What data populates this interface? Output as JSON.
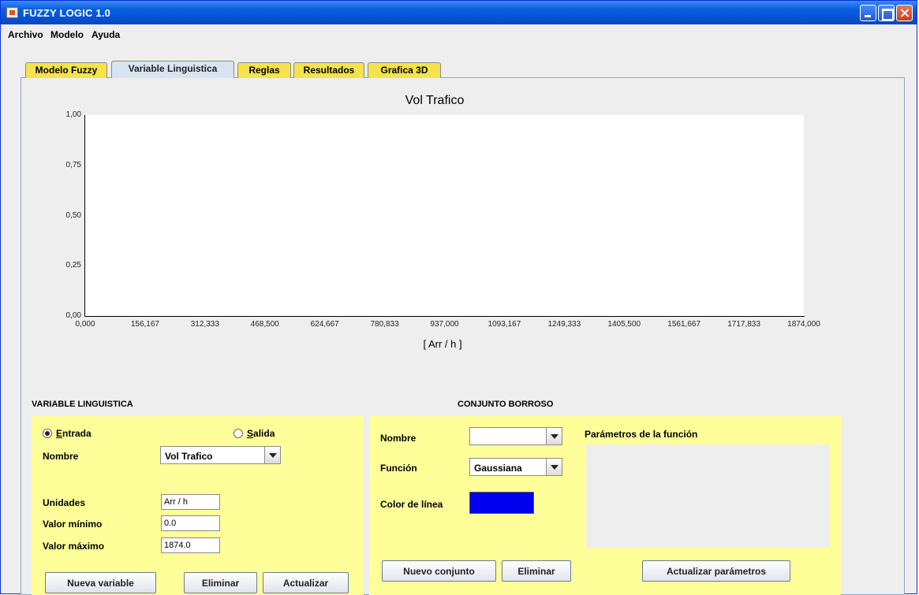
{
  "window": {
    "title": "FUZZY LOGIC 1.0"
  },
  "menu": [
    "Archivo",
    "Modelo",
    "Ayuda"
  ],
  "tabs": [
    "Modelo Fuzzy",
    "Variable Linguistica",
    "Reglas",
    "Resultados",
    "Grafica 3D"
  ],
  "active_tab": "Variable Linguistica",
  "chart_data": {
    "type": "line",
    "title": "Vol Trafico",
    "xlabel": "[ Arr / h ]",
    "ylabel": "",
    "xlim": [
      0,
      1874
    ],
    "ylim": [
      0,
      1
    ],
    "x_ticks": [
      "0,000",
      "156,167",
      "312,333",
      "468,500",
      "624,667",
      "780,833",
      "937,000",
      "1093,167",
      "1249,333",
      "1405,500",
      "1561,667",
      "1717,833",
      "1874,000"
    ],
    "y_ticks": [
      "1,00",
      "0,75",
      "0,50",
      "0,25",
      "0,00"
    ],
    "series": []
  },
  "variable_panel": {
    "title": "VARIABLE LINGUISTICA",
    "radio_entrada": "Entrada",
    "radio_salida": "Salida",
    "selected": "Entrada",
    "nombre_label": "Nombre",
    "nombre_value": "Vol Trafico",
    "unidades_label": "Unidades",
    "unidades_value": "Arr / h",
    "min_label": "Valor mínimo",
    "min_value": "0.0",
    "max_label": "Valor máximo",
    "max_value": "1874.0",
    "btn_new": "Nueva variable",
    "btn_delete": "Eliminar",
    "btn_update": "Actualizar"
  },
  "set_panel": {
    "title": "CONJUNTO BORROSO",
    "nombre_label": "Nombre",
    "nombre_value": "",
    "funcion_label": "Función",
    "funcion_value": "Gaussiana",
    "color_label": "Color de línea",
    "line_color": "#0000ee",
    "params_label": "Parámetros de la función",
    "btn_new": "Nuevo conjunto",
    "btn_delete": "Eliminar",
    "btn_update": "Actualizar parámetros"
  }
}
